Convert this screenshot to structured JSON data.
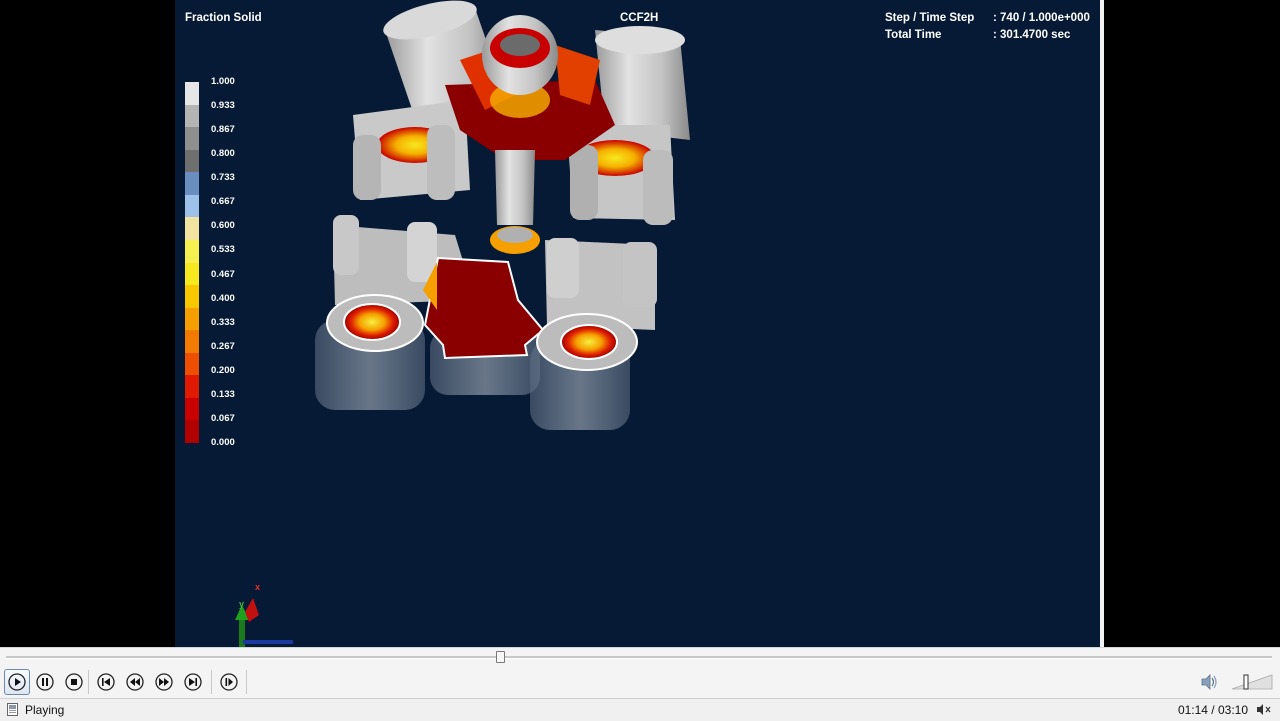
{
  "viewer": {
    "variable_title": "Fraction Solid",
    "model_name": "CCF2H",
    "step_label": "Step / Time Step",
    "step_value": ": 740 / 1.000e+000",
    "time_label": "Total  Time",
    "time_value": ": 301.4700 sec"
  },
  "legend": {
    "labels": [
      "1.000",
      "0.933",
      "0.867",
      "0.800",
      "0.733",
      "0.667",
      "0.600",
      "0.533",
      "0.467",
      "0.400",
      "0.333",
      "0.267",
      "0.200",
      "0.133",
      "0.067",
      "0.000"
    ],
    "colors": [
      "#e6e6e6",
      "#b4b4b4",
      "#8f8f8f",
      "#6f6f6f",
      "#6a8ec0",
      "#9ec1ea",
      "#f2e2a0",
      "#f5ef50",
      "#f7e820",
      "#f7c800",
      "#f5a000",
      "#f27a00",
      "#ee4e00",
      "#e01a00",
      "#c80000",
      "#b00000"
    ]
  },
  "axes": {
    "x": "x",
    "y": "y"
  },
  "player": {
    "status": "Playing",
    "time": "01:14 / 03:10",
    "seek_fraction": 0.39
  },
  "colors": {
    "viewport_bg": "#061a35",
    "hot": "#8a0000",
    "gray_part": "#cfcfcf"
  }
}
